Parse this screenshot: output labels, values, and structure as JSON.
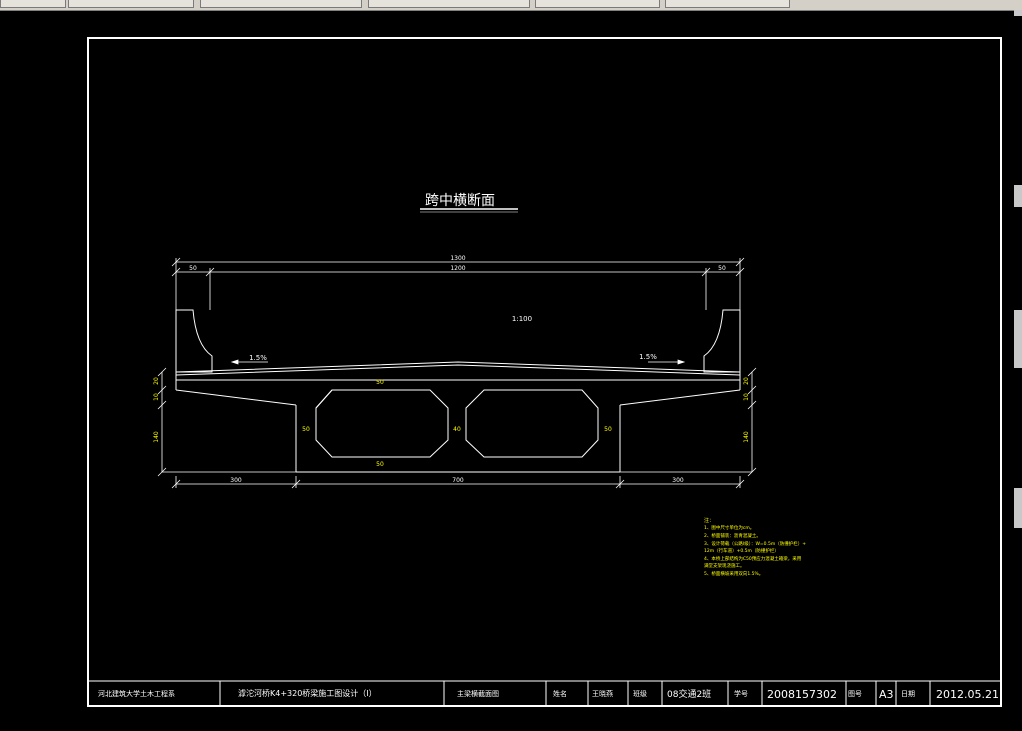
{
  "taskbar": {
    "buttons": [
      "",
      "",
      "",
      "",
      "",
      ""
    ]
  },
  "drawing": {
    "title": "跨中横断面",
    "scale": "1:100",
    "dims": {
      "total_width": "1300",
      "inner_width": "1200",
      "left_edge": "50",
      "right_edge": "50",
      "slope_left": "1.5%",
      "slope_right": "1.5%",
      "bottom_left": "300",
      "bottom_center": "700",
      "bottom_right": "300",
      "web_left": "50",
      "web_mid": "40",
      "web_right": "50",
      "top_slab": "50",
      "bottom_slab": "50",
      "left_v1": "20",
      "left_v2": "10",
      "left_v3": "140",
      "right_v1": "20",
      "right_v2": "10",
      "right_v3": "140"
    },
    "notes_header": "注：",
    "notes": [
      "1、图中尺寸单位为cm。",
      "2、桥面铺装：沥青混凝土。",
      "3、设计荷载（公路Ⅰ级）：W=0.5m（防撞护栏）+",
      "   12m（行车道）+0.5m（防撞护栏）",
      "4、本桥上部结构为C50预应力混凝土箱梁，采用",
      "   满堂支架现浇施工。",
      "5、桥面横坡采用双向1.5%。"
    ]
  },
  "title_block": {
    "school": "河北建筑大学土木工程系",
    "project": "滹沱河桥K4+320桥梁施工图设计（Ⅰ）",
    "sheet": "主梁横截面图",
    "name_label": "姓名",
    "name": "王晓燕",
    "class_label": "班级",
    "class_value": "08交通2班",
    "id_label": "学号",
    "id_value": "2008157302",
    "num_label": "图号",
    "num_value": "A3",
    "date_label": "日期",
    "date_value": "2012.05.21"
  }
}
